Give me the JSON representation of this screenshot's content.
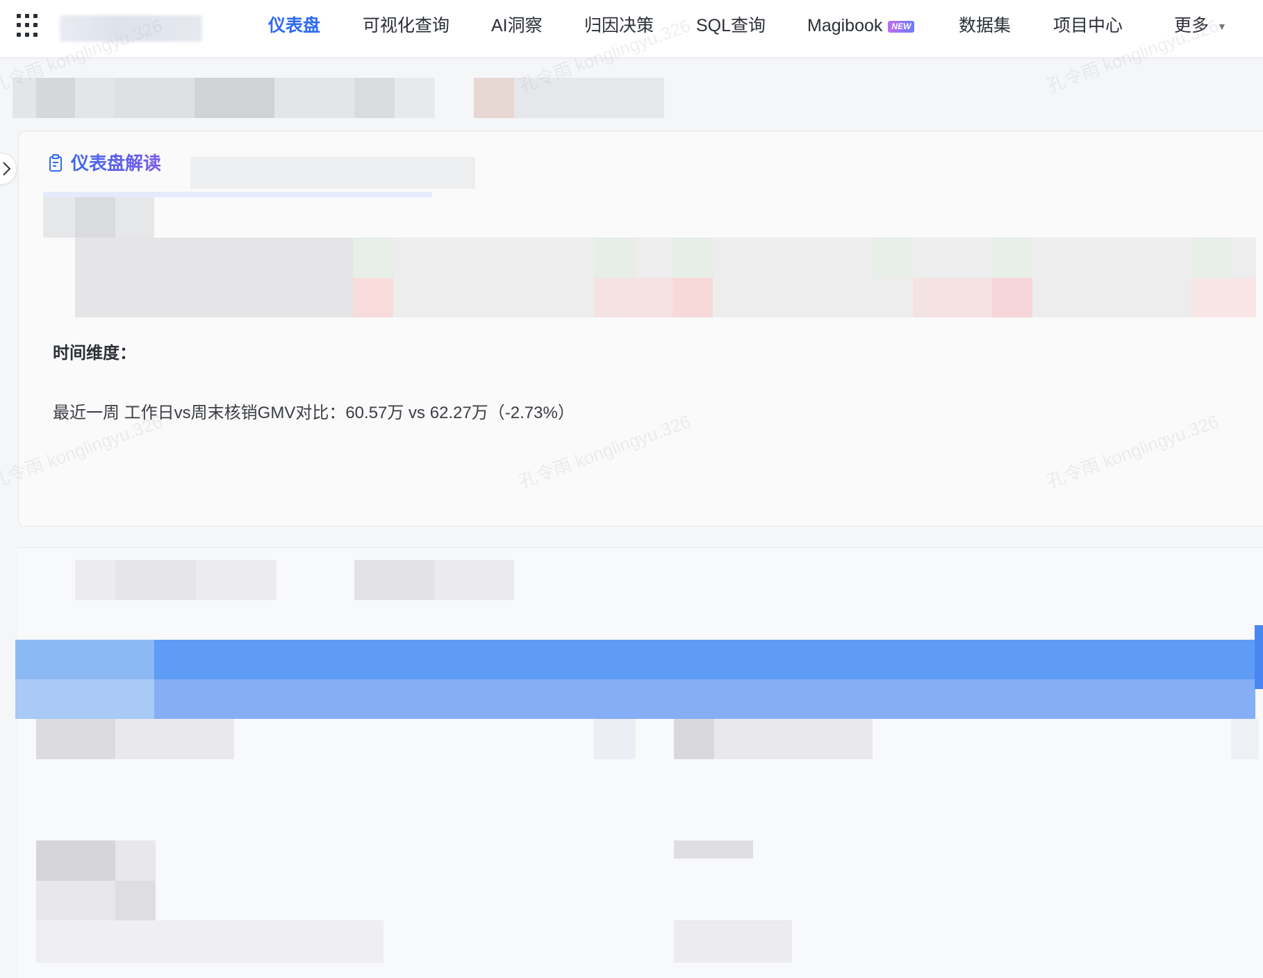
{
  "topbar": {
    "nav": [
      {
        "label": "仪表盘",
        "active": true
      },
      {
        "label": "可视化查询",
        "active": false
      },
      {
        "label": "AI洞察",
        "active": false
      },
      {
        "label": "归因决策",
        "active": false
      },
      {
        "label": "SQL查询",
        "active": false
      },
      {
        "label": "Magibook",
        "active": false,
        "badge": "NEW"
      },
      {
        "label": "数据集",
        "active": false
      },
      {
        "label": "项目中心",
        "active": false
      },
      {
        "label": "更多",
        "active": false
      }
    ]
  },
  "card": {
    "title": "仪表盘解读",
    "section_label": "时间维度：",
    "summary": "最近一周 工作日vs周末核销GMV对比：60.57万 vs 62.27万（-2.73%）"
  },
  "watermark": "孔令雨 konglingyu.326",
  "colors": {
    "primary": "#2f6bef",
    "accent_gradient_end": "#7a59e8",
    "blue_bar": "#5f9cf5"
  }
}
